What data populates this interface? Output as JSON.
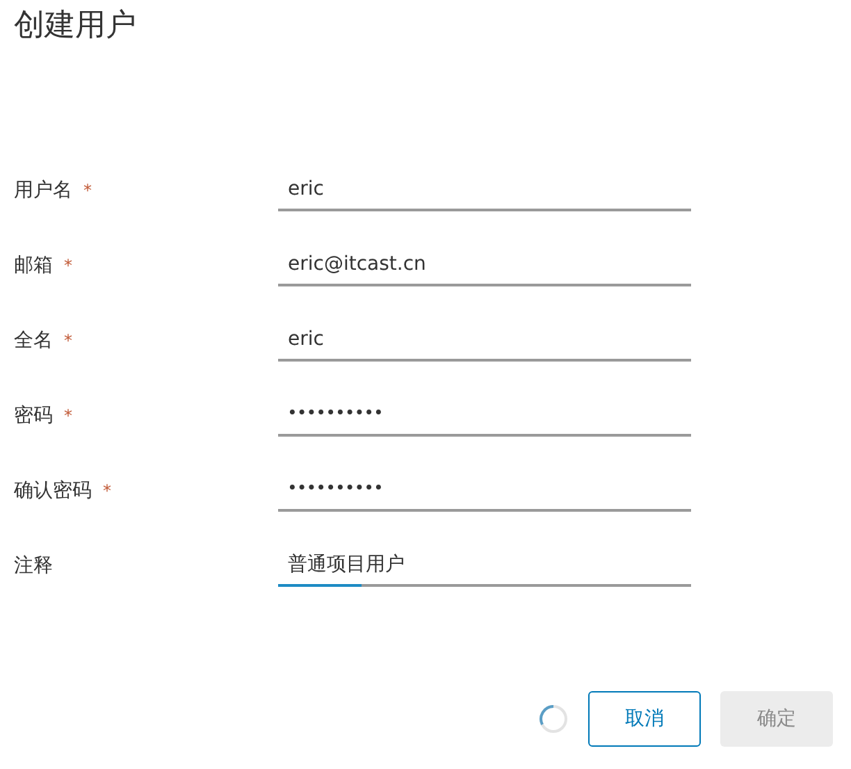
{
  "title": "创建用户",
  "fields": [
    {
      "label": "用户名",
      "required_mark": "*",
      "kind": "text",
      "value": "eric",
      "focused": false
    },
    {
      "label": "邮箱",
      "required_mark": "*",
      "kind": "text",
      "value": "eric@itcast.cn",
      "focused": false
    },
    {
      "label": "全名",
      "required_mark": "*",
      "kind": "text",
      "value": "eric",
      "focused": false
    },
    {
      "label": "密码",
      "required_mark": "*",
      "kind": "password",
      "value": "••••••••••",
      "focused": false
    },
    {
      "label": "确认密码",
      "required_mark": "*",
      "kind": "password",
      "value": "••••••••••",
      "focused": false
    },
    {
      "label": "注释",
      "kind": "text",
      "value": "普通项目用户",
      "focused": true
    }
  ],
  "loading": true,
  "buttons": [
    {
      "label": "取消",
      "kind": "outline",
      "disabled": false
    },
    {
      "label": "确定",
      "kind": "primary",
      "disabled": true
    }
  ]
}
